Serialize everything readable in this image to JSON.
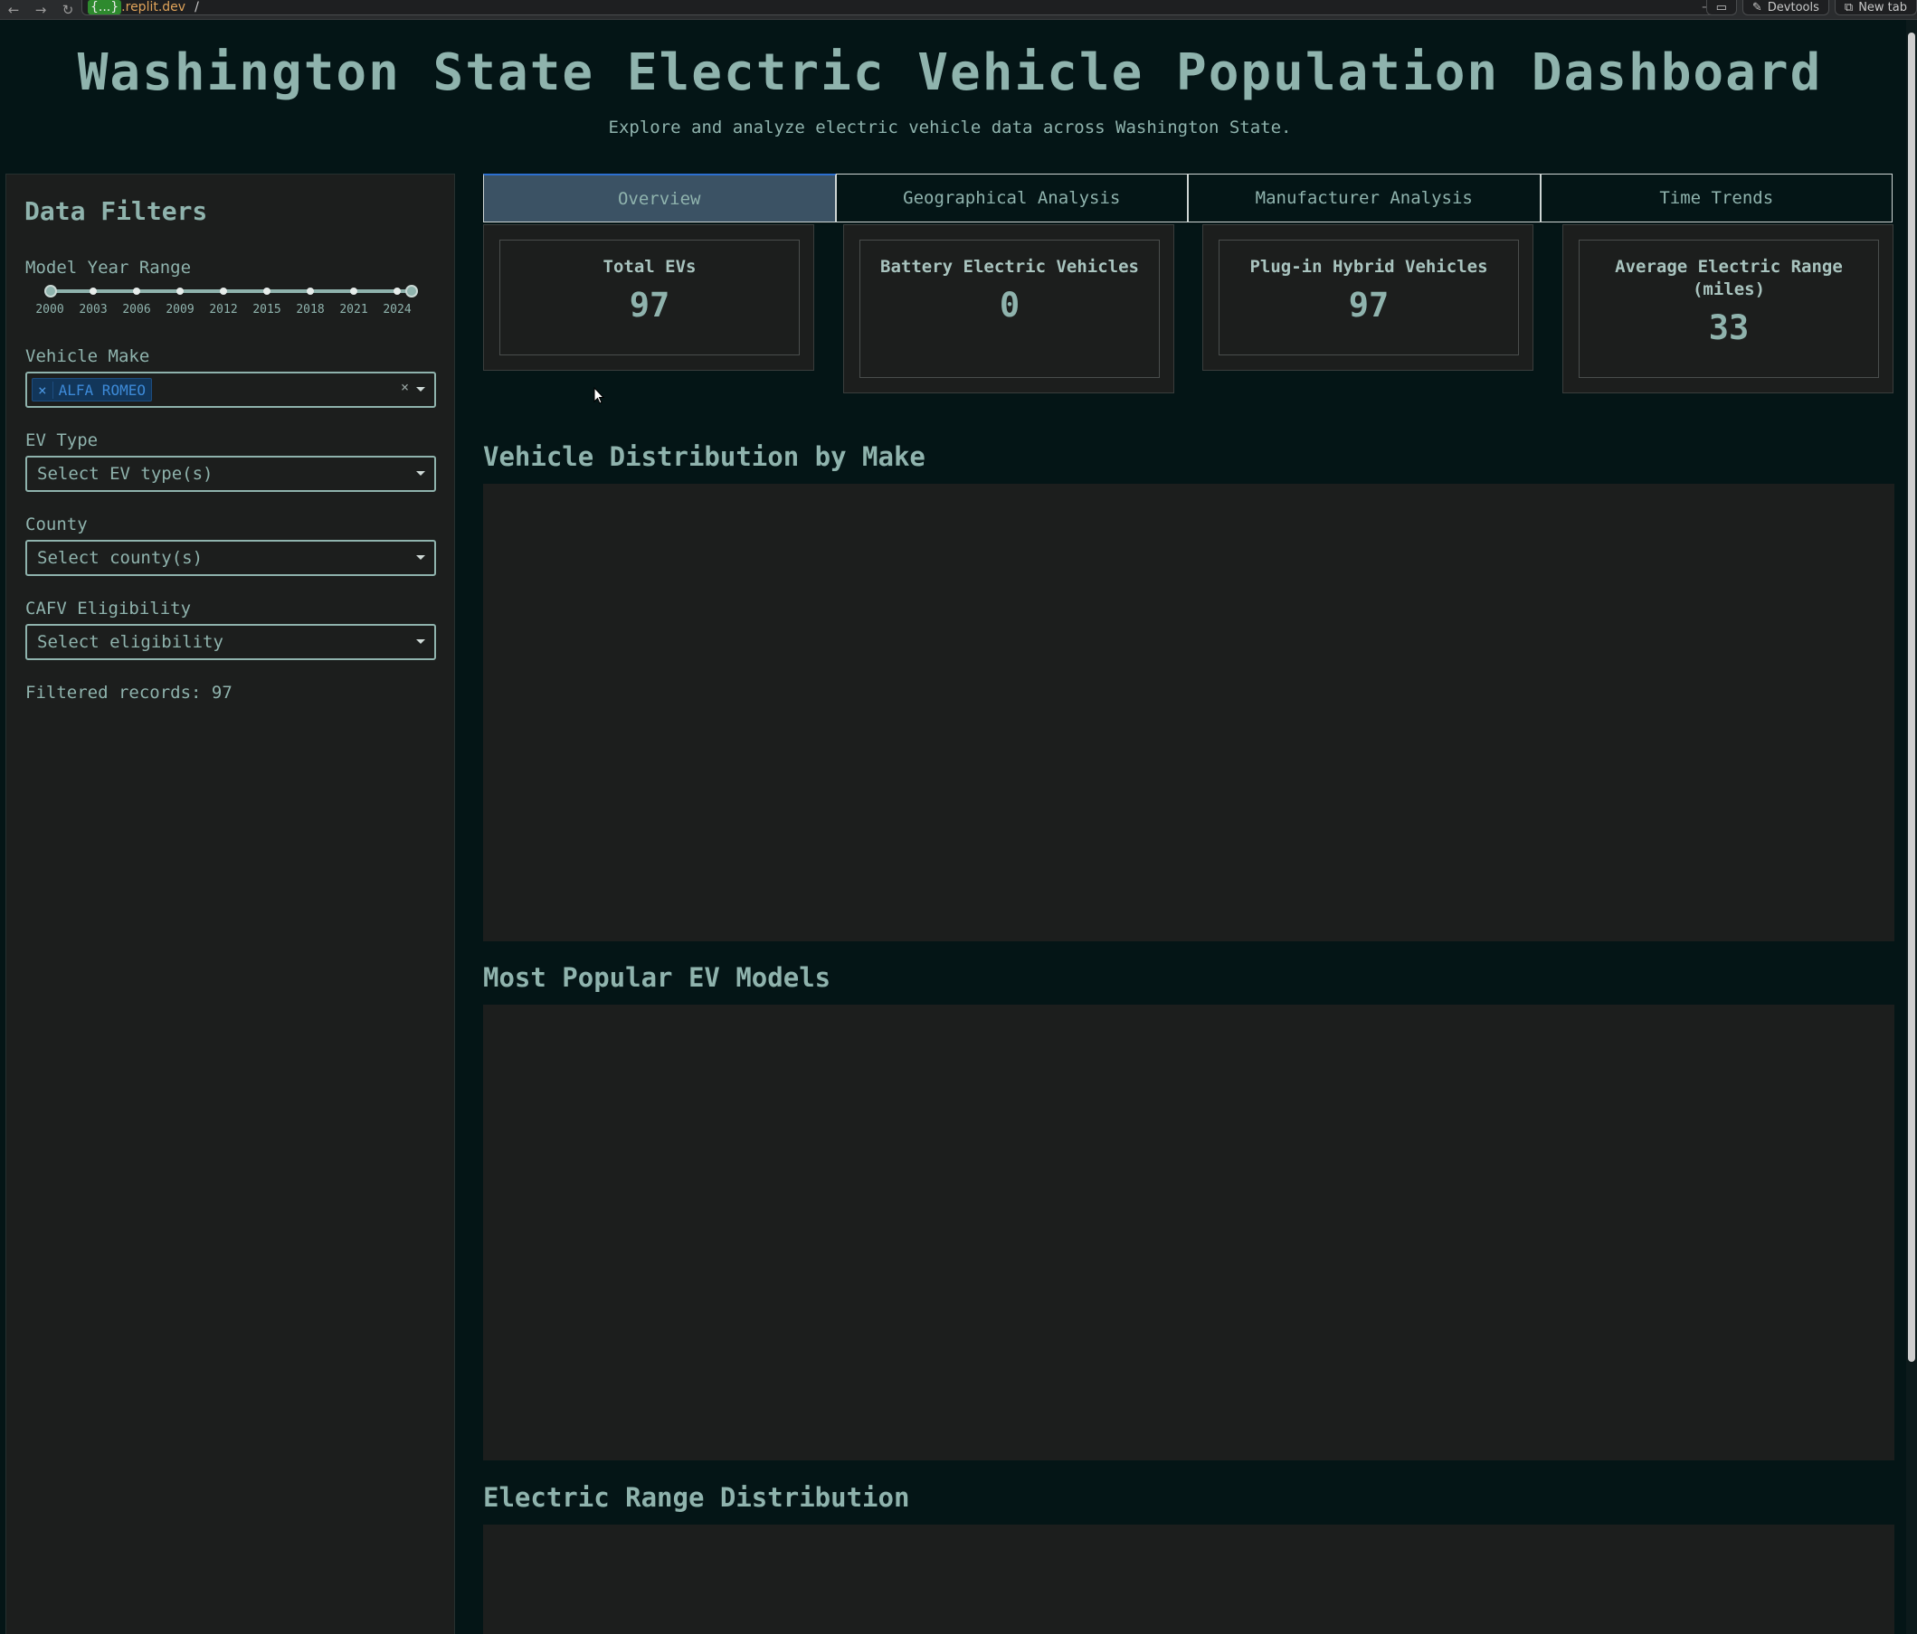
{
  "browser": {
    "url_host_prefix": "{...}",
    "url_host_suffix": ".replit.dev",
    "url_path": "/",
    "devtools_label": "Devtools",
    "newtab_label": "New tab"
  },
  "header": {
    "title": "Washington State Electric Vehicle Population Dashboard",
    "subtitle": "Explore and analyze electric vehicle data across Washington State."
  },
  "sidebar": {
    "title": "Data Filters",
    "model_year": {
      "label": "Model Year Range",
      "ticks": [
        "2000",
        "2003",
        "2006",
        "2009",
        "2012",
        "2015",
        "2018",
        "2021",
        "2024"
      ],
      "min": 2000,
      "max": 2025,
      "selected_min": 2000,
      "selected_max": 2025
    },
    "vehicle_make": {
      "label": "Vehicle Make",
      "selected": "ALFA ROMEO",
      "chip_remove": "×",
      "clear": "×"
    },
    "ev_type": {
      "label": "EV Type",
      "placeholder": "Select EV type(s)"
    },
    "county": {
      "label": "County",
      "placeholder": "Select county(s)"
    },
    "cafv": {
      "label": "CAFV Eligibility",
      "placeholder": "Select eligibility"
    },
    "filtered_records": "Filtered records: 97"
  },
  "tabs": [
    "Overview",
    "Geographical Analysis",
    "Manufacturer Analysis",
    "Time Trends"
  ],
  "active_tab": "Overview",
  "kpis": [
    {
      "title": "Total EVs",
      "value": "97"
    },
    {
      "title": "Battery Electric Vehicles",
      "value": "0"
    },
    {
      "title": "Plug-in Hybrid Vehicles",
      "value": "97"
    },
    {
      "title": "Average Electric Range (miles)",
      "value": "33"
    }
  ],
  "sections": [
    {
      "title": "Vehicle Distribution by Make"
    },
    {
      "title": "Most Popular EV Models"
    },
    {
      "title": "Electric Range Distribution"
    }
  ],
  "colors": {
    "background": "#041516",
    "panel": "#1c1e1d",
    "text": "#8fb3ad",
    "active_tab": "#3b5264",
    "chip": "#12365a"
  }
}
